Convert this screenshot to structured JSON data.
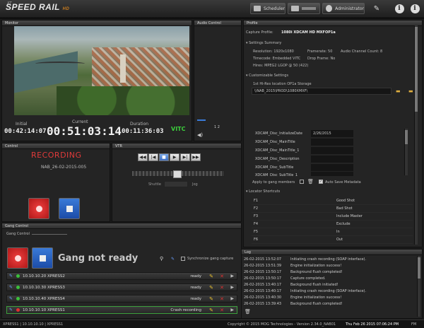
{
  "header": {
    "logo_main": "SPEED RAIL",
    "logo_prefix": "XT",
    "logo_suffix": "HD",
    "scheduler_label": "Scheduler",
    "admin_label": "Administrator"
  },
  "monitor": {
    "title": "Monitor",
    "initial_label": "Initial",
    "current_label": "Current",
    "duration_label": "Duration",
    "initial_tc": "00:42:14:07",
    "current_tc": "00:51:03:14",
    "duration_tc": "00:11:36:03",
    "tc_source": "VITC"
  },
  "audio": {
    "title": "Audio Control",
    "level_label": "1 2"
  },
  "control": {
    "title": "Control",
    "state": "RECORDING",
    "clip_name": "NAB_26-02-2015-005"
  },
  "vtr": {
    "title": "VTR",
    "shuttle_label": "Shuttle",
    "jog_label": "Jog"
  },
  "gang": {
    "title": "Gang Control",
    "sub_label": "Gang Control",
    "status_text": "Gang not ready",
    "sync_label": "Synchronize gang capture",
    "rows": [
      {
        "name": "10.10.10.20 XPRESS2",
        "status": "ready",
        "color": "#3cc03c"
      },
      {
        "name": "10.10.10.30 XPRESS3",
        "status": "ready",
        "color": "#3cc03c"
      },
      {
        "name": "10.10.10.40 XPRESS4",
        "status": "ready",
        "color": "#3cc03c"
      },
      {
        "name": "10.10.10.10 XPRESS1",
        "status": "Crash recording",
        "color": "#e03030"
      }
    ]
  },
  "profile": {
    "title": "Profile",
    "capture_profile_label": "Capture Profile:",
    "capture_profile_value": "1080i XDCAM HD MXFOP1a",
    "settings_summary_label": "Settings Summary",
    "resolution_label": "Resolution:",
    "resolution_value": "1920x1080",
    "framerate_label": "Framerate:",
    "framerate_value": "50",
    "audio_channel_label": "Audio Channel Count:",
    "audio_channel_value": "8",
    "timecode_label": "Timecode:",
    "timecode_value": "Embedded VITC",
    "dropframe_label": "Drop Frame:",
    "dropframe_value": "No",
    "hires_label": "Hires:",
    "hires_value": "MPEG2 LGOP @ 50 (422)",
    "customizable_label": "Customizable Settings",
    "location_label": "1st Hi-Res location",
    "location_value": "OP1a Storage",
    "path_value": "\\\\NAB_2015\\PROD\\1080XMXF\\",
    "metadata": [
      {
        "key": "XDCAM_Disc_InitializeDate",
        "value": "2/26/2015"
      },
      {
        "key": "XDCAM_Disc_MainTitle",
        "value": ""
      },
      {
        "key": "XDCAM_Disc_MainTitle_1",
        "value": ""
      },
      {
        "key": "XDCAM_Disc_Description",
        "value": ""
      },
      {
        "key": "XDCAM_Disc_SubTitle",
        "value": ""
      },
      {
        "key": "XDCAM_Disc_SubTitle_1",
        "value": ""
      }
    ],
    "apply_label": "Apply to gang members",
    "autosave_label": "Auto Save Metadata",
    "locator_label": "Locator Shortcuts",
    "shortcuts": [
      {
        "key": "F1",
        "value": "Good Shot"
      },
      {
        "key": "F2",
        "value": "Bad Shot"
      },
      {
        "key": "F3",
        "value": "Include Master"
      },
      {
        "key": "F4",
        "value": "Exclude"
      },
      {
        "key": "F5",
        "value": "In"
      },
      {
        "key": "F6",
        "value": "Out"
      }
    ]
  },
  "log": {
    "title": "Log",
    "entries": [
      {
        "time": "26-02-2015 13:52:07",
        "msg": "Initiating crash recording (SOAP interface)."
      },
      {
        "time": "26-02-2015 13:51:39",
        "msg": "Engine initialization success!"
      },
      {
        "time": "26-02-2015 13:50:17",
        "msg": "Background flush completed!"
      },
      {
        "time": "26-02-2015 13:50:17",
        "msg": "Capture completed."
      },
      {
        "time": "26-02-2015 13:40:17",
        "msg": "Background flush initiated!"
      },
      {
        "time": "26-02-2015 13:40:17",
        "msg": "Initiating crash recording (SOAP interface)."
      },
      {
        "time": "26-02-2015 13:40:30",
        "msg": "Engine initialization success!"
      },
      {
        "time": "26-02-2015 13:39:43",
        "msg": "Background flush completed!"
      }
    ]
  },
  "statusbar": {
    "left": "XPRESS1  |  10.10.10.10  |  XPRESS1",
    "copyright": "Copyright © 2015 MOG Technologies - Version 2.34.0_NAB01",
    "datetime": "Thu Feb 26 2015  07:06:24 PM",
    "corner": "FM"
  }
}
